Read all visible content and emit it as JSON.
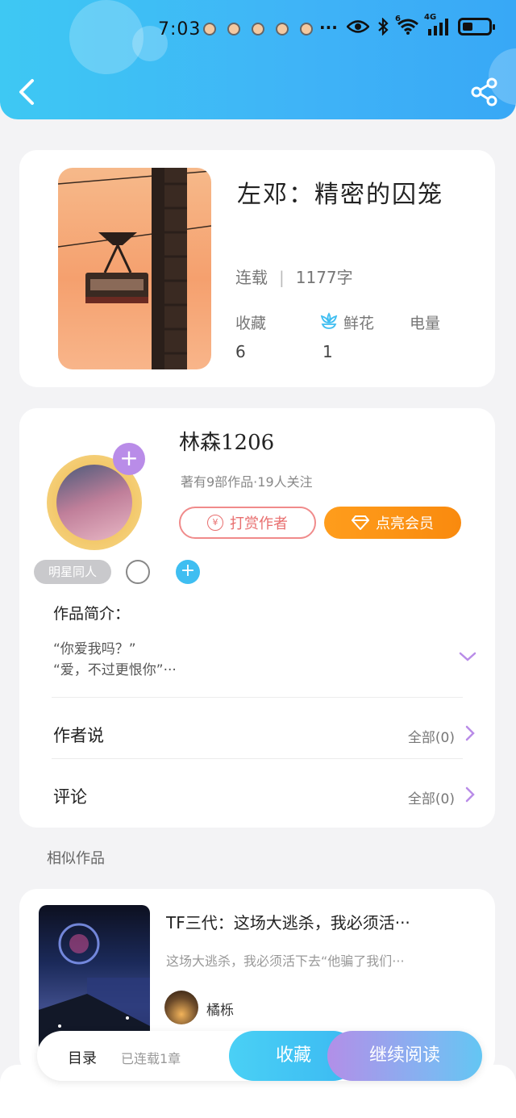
{
  "status_bar": {
    "time": "7:03",
    "dots": "···",
    "network": "4G",
    "wifi_tag": "6"
  },
  "book": {
    "title": "左邓：精密的囚笼",
    "status": "连载",
    "word_count": "1177字",
    "stats": [
      {
        "label": "收藏",
        "value": "6"
      },
      {
        "label": "鲜花",
        "value": "1"
      },
      {
        "label": "电量",
        "value": ""
      }
    ]
  },
  "author": {
    "name": "林森1206",
    "meta": "著有9部作品·19人关注",
    "reward_label": "打赏作者",
    "reward_icon": "¥",
    "vip_label": "点亮会员",
    "tag": "明星同人"
  },
  "intro": {
    "title": "作品简介：",
    "lines": [
      "“你爱我吗？”",
      "“爱，不过更恨你”···"
    ]
  },
  "rows": {
    "author_says": {
      "label": "作者说",
      "right": "全部(0)"
    },
    "comments": {
      "label": "评论",
      "right": "全部(0)"
    }
  },
  "similar": {
    "section_title": "相似作品",
    "item": {
      "title": "TF三代：这场大逃杀，我必须活···",
      "desc": "这场大逃杀，我必须活下去“他骗了我们···",
      "author": "橘栎"
    }
  },
  "bottom_bar": {
    "toc_label": "目录",
    "toc_count": "已连载1章",
    "favorite_label": "收藏",
    "read_label": "继续阅读"
  },
  "colors": {
    "header": "#3fb3f7",
    "vip": "#ff9d1c",
    "reward": "#e86f6f",
    "accent_purple": "#b98ce8",
    "accent_blue": "#3fbef1"
  },
  "icons": [
    "back-arrow-icon",
    "share-icon",
    "flower-icon",
    "diamond-icon",
    "chevron-down-icon",
    "chevron-right-icon",
    "plus-icon"
  ]
}
